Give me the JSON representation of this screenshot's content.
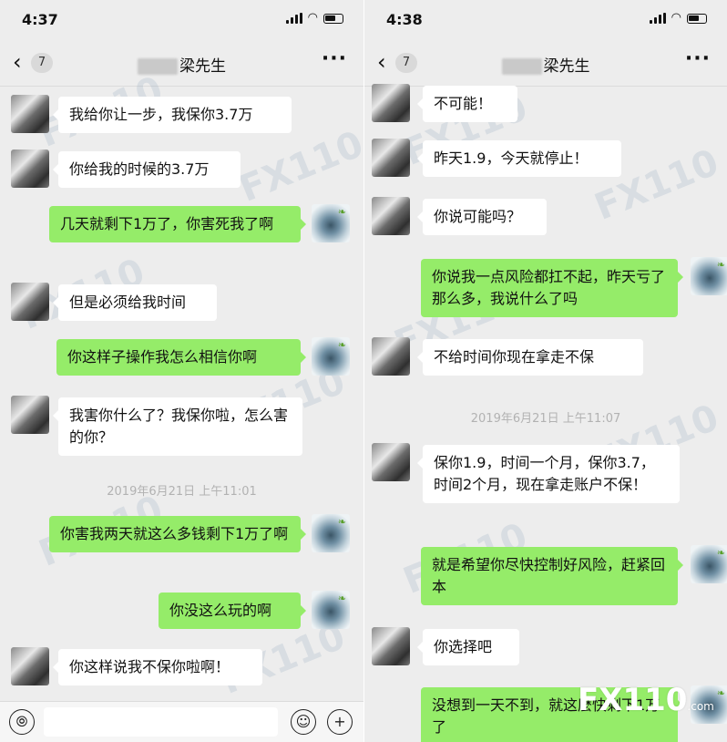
{
  "left": {
    "status_time": "4:37",
    "unread_count": "7",
    "contact_name": "梁先生",
    "more_label": "···",
    "messages": [
      {
        "text": "我给你让一步，我保你3.7万"
      },
      {
        "text": "你给我的时候的3.7万"
      },
      {
        "text": "几天就剩下1万了，你害死我了啊"
      },
      {
        "text": "但是必须给我时间"
      },
      {
        "text": "你这样子操作我怎么相信你啊"
      },
      {
        "text": "我害你什么了？我保你啦，怎么害的你？"
      },
      {
        "text": "你害我两天就这么多钱剩下1万了啊"
      },
      {
        "text": "你没这么玩的啊"
      },
      {
        "text": "你这样说我不保你啦啊！"
      }
    ],
    "timestamp": "2019年6月21日 上午11:01"
  },
  "right": {
    "status_time": "4:38",
    "unread_count": "7",
    "contact_name": "梁先生",
    "more_label": "···",
    "messages": [
      {
        "text": "不可能！"
      },
      {
        "text": "昨天1.9，今天就停止！"
      },
      {
        "text": "你说可能吗？"
      },
      {
        "text": "你说我一点风险都扛不起，昨天亏了那么多，我说什么了吗"
      },
      {
        "text": "不给时间你现在拿走不保"
      },
      {
        "text": "保你1.9，时间一个月，保你3.7，时间2个月，现在拿走账户不保！"
      },
      {
        "text": "就是希望你尽快控制好风险，赶紧回本"
      },
      {
        "text": "你选择吧"
      },
      {
        "text": "没想到一天不到，就这麽快剩下1万了"
      }
    ],
    "timestamp": "2019年6月21日 上午11:07"
  },
  "watermark": {
    "text": "FX110",
    "suffix": ".com"
  },
  "colors": {
    "outgoing_bubble": "#95ec69",
    "incoming_bubble": "#ffffff",
    "background": "#ededed"
  },
  "icons": {
    "back": "chevron-left-icon",
    "more": "more-dots-icon",
    "voice": "voice-icon",
    "emoji": "emoji-icon",
    "add": "plus-icon"
  }
}
